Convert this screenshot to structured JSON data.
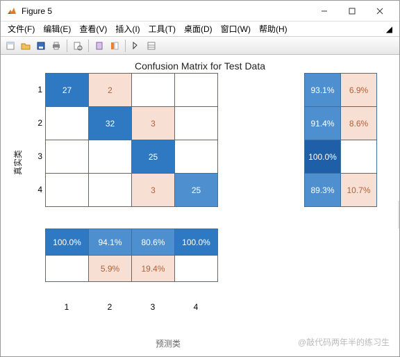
{
  "window": {
    "title": "Figure 5"
  },
  "menu": {
    "file": "文件(F)",
    "edit": "编辑(E)",
    "view": "查看(V)",
    "insert": "插入(I)",
    "tools": "工具(T)",
    "desktop": "桌面(D)",
    "window": "窗口(W)",
    "help": "帮助(H)"
  },
  "chart_data": {
    "type": "heatmap",
    "title": "Confusion Matrix for Test Data",
    "xlabel": "预测类",
    "ylabel": "真实类",
    "row_labels": [
      "1",
      "2",
      "3",
      "4"
    ],
    "col_labels": [
      "1",
      "2",
      "3",
      "4"
    ],
    "matrix": [
      [
        27,
        2,
        0,
        0
      ],
      [
        0,
        32,
        3,
        0
      ],
      [
        0,
        0,
        25,
        0
      ],
      [
        0,
        0,
        3,
        25
      ]
    ],
    "row_summary": [
      {
        "correct_pct": "93.1%",
        "error_pct": "6.9%"
      },
      {
        "correct_pct": "91.4%",
        "error_pct": "8.6%"
      },
      {
        "correct_pct": "100.0%",
        "error_pct": ""
      },
      {
        "correct_pct": "89.3%",
        "error_pct": "10.7%"
      }
    ],
    "col_summary": [
      {
        "correct_pct": "100.0%",
        "error_pct": ""
      },
      {
        "correct_pct": "94.1%",
        "error_pct": "5.9%"
      },
      {
        "correct_pct": "80.6%",
        "error_pct": "19.4%"
      },
      {
        "correct_pct": "100.0%",
        "error_pct": ""
      }
    ]
  },
  "watermark": "@敲代码两年半的练习生"
}
